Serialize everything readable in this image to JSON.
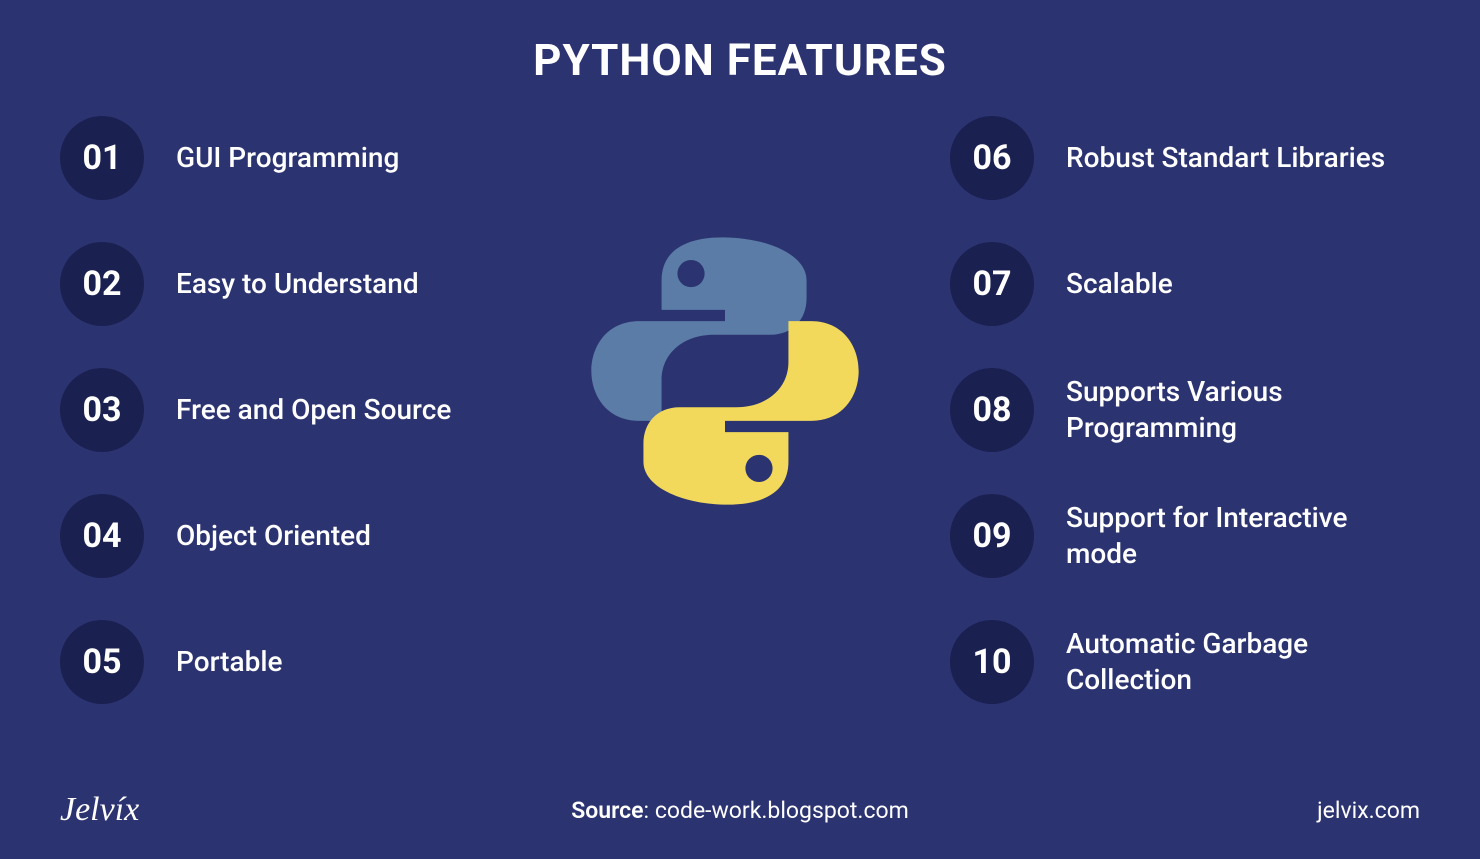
{
  "title": "PYTHON FEATURES",
  "features_left": [
    {
      "num": "01",
      "label": "GUI Programming"
    },
    {
      "num": "02",
      "label": "Easy to Understand"
    },
    {
      "num": "03",
      "label": "Free and Open Source"
    },
    {
      "num": "04",
      "label": "Object Oriented"
    },
    {
      "num": "05",
      "label": "Portable"
    }
  ],
  "features_right": [
    {
      "num": "06",
      "label": "Robust Standart Libraries"
    },
    {
      "num": "07",
      "label": "Scalable"
    },
    {
      "num": "08",
      "label": "Supports Various Programming"
    },
    {
      "num": "09",
      "label": "Support for Interactive mode"
    },
    {
      "num": "10",
      "label": "Automatic Garbage Collection"
    }
  ],
  "icon_name": "python-logo-icon",
  "footer": {
    "brand": "Jelvíx",
    "source_label": "Source",
    "source_value": ": code-work.blogspot.com",
    "site": "jelvix.com"
  },
  "colors": {
    "background": "#2c3371",
    "circle": "#1a2050",
    "text": "#ffffff",
    "python_blue": "#5a7ca6",
    "python_yellow": "#f2d95b"
  }
}
